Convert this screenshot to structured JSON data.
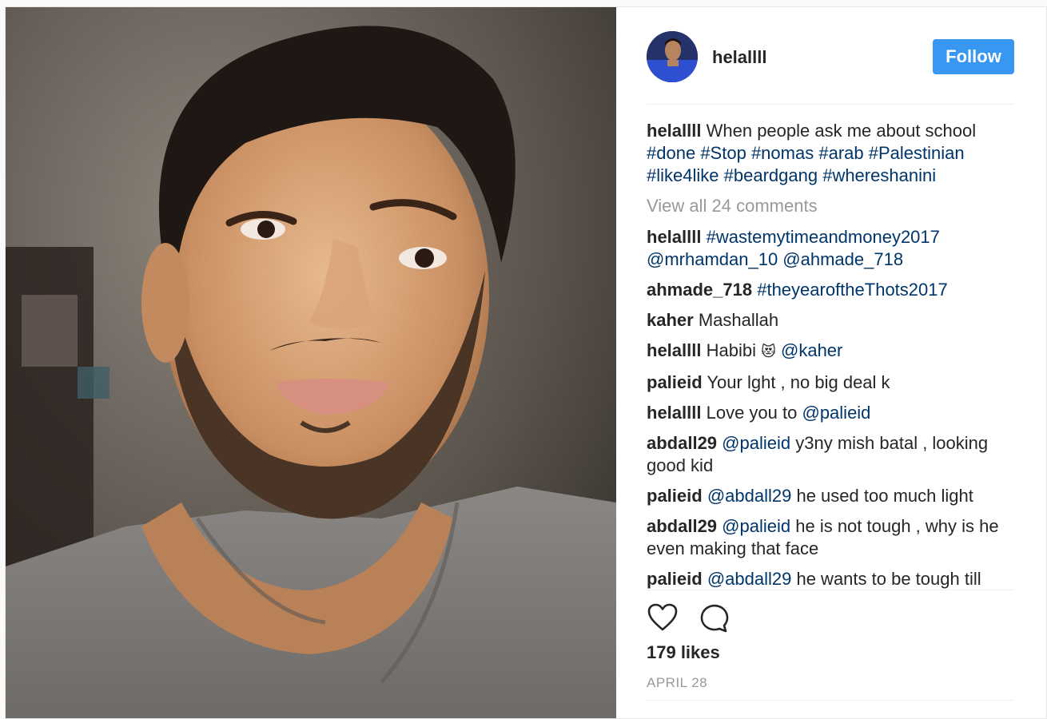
{
  "post": {
    "username": "helallll",
    "follow_label": "Follow",
    "caption": {
      "user": "helallll",
      "text": "When people ask me about school",
      "hashtags": [
        "#done",
        "#Stop",
        "#nomas",
        "#arab",
        "#Palestinian",
        "#like4like",
        "#beardgang",
        "#whereshanini"
      ]
    },
    "view_all_comments": "View all 24 comments",
    "comments": [
      {
        "user": "helallll",
        "text": "#wastemytimeandmoney2017 @mrhamdan_10 @ahmade_718"
      },
      {
        "user": "ahmade_718",
        "text": "#theyearoftheThots2017"
      },
      {
        "user": "kaher",
        "text": "Mashallah"
      },
      {
        "user": "helallll",
        "text": "Habibi",
        "emoji": "😻",
        "mention": "@kaher"
      },
      {
        "user": "palieid",
        "text": "Your lght , no big deal k"
      },
      {
        "user": "helallll",
        "text": "Love you to",
        "mention": "@palieid"
      },
      {
        "user": "abdall29",
        "mention": "@palieid",
        "text": "y3ny mish batal , looking good kid"
      },
      {
        "user": "palieid",
        "mention": "@abdall29",
        "text": "he used too much light"
      },
      {
        "user": "abdall29",
        "mention": "@palieid",
        "text": "he is not tough , why is he even making that face"
      },
      {
        "user": "palieid",
        "mention": "@abdall29",
        "text": "he wants to be tough till"
      }
    ],
    "likes": "179 likes",
    "date": "APRIL 28",
    "icons": {
      "like": "heart-icon",
      "comment": "comment-bubble-icon"
    },
    "colors": {
      "follow_button": "#3897f0",
      "link": "#003569",
      "muted": "#999999"
    }
  }
}
